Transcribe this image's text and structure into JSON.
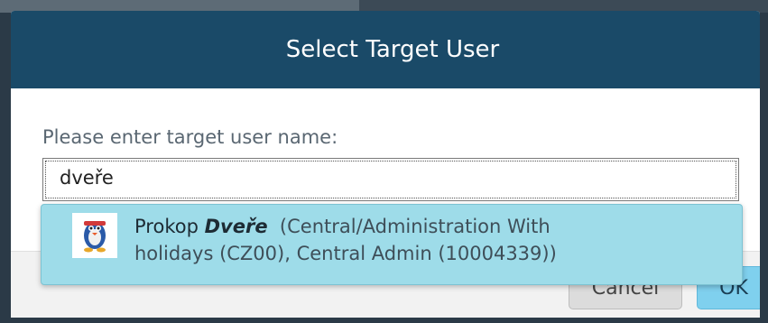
{
  "dialog": {
    "title": "Select Target User",
    "prompt": "Please enter target user name:",
    "input_value": "dveře",
    "cancel_label": "Cancel",
    "ok_label": "OK"
  },
  "suggestion": {
    "first_name": "Prokop",
    "last_name": "Dveře",
    "details_line1": "(Central/Administration With",
    "details_line2": "holidays (CZ00), Central Admin (10004339))",
    "avatar_icon": "user-avatar-icon"
  },
  "colors": {
    "header": "#1a4a68",
    "suggestion_bg": "#9edce9",
    "ok_button": "#7fd0ee"
  }
}
